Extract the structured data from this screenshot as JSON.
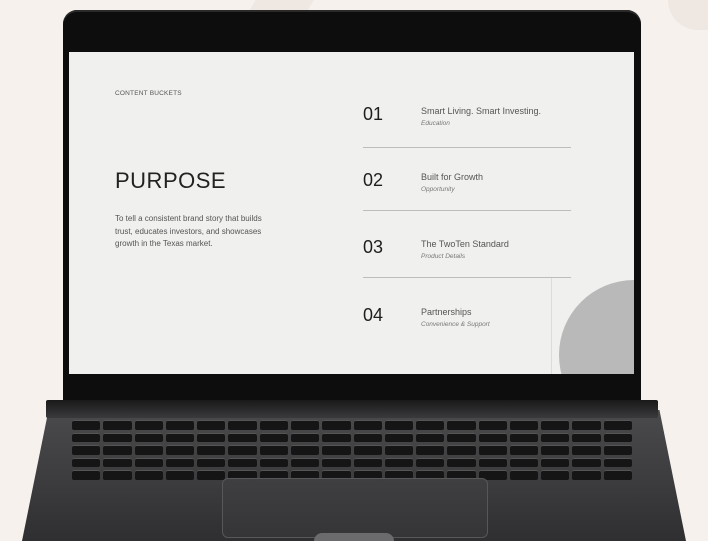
{
  "slide": {
    "top_label": "CONTENT BUCKETS",
    "heading": "PURPOSE",
    "description": "To tell a consistent brand story that builds trust, educates investors, and showcases growth in the Texas market.",
    "items": [
      {
        "number": "01",
        "title": "Smart Living. Smart Investing.",
        "subtitle": "Education"
      },
      {
        "number": "02",
        "title": "Built for Growth",
        "subtitle": "Opportunity"
      },
      {
        "number": "03",
        "title": "The TwoTen Standard",
        "subtitle": "Product Details"
      },
      {
        "number": "04",
        "title": "Partnerships",
        "subtitle": "Convenience & Support"
      }
    ]
  },
  "colors": {
    "background": "#f6f1ec",
    "slide_background": "#f0f0ef",
    "laptop_bezel": "#0d0d0e",
    "laptop_body": "#3c3c3e",
    "accent_circle": "#b9b9b9"
  }
}
